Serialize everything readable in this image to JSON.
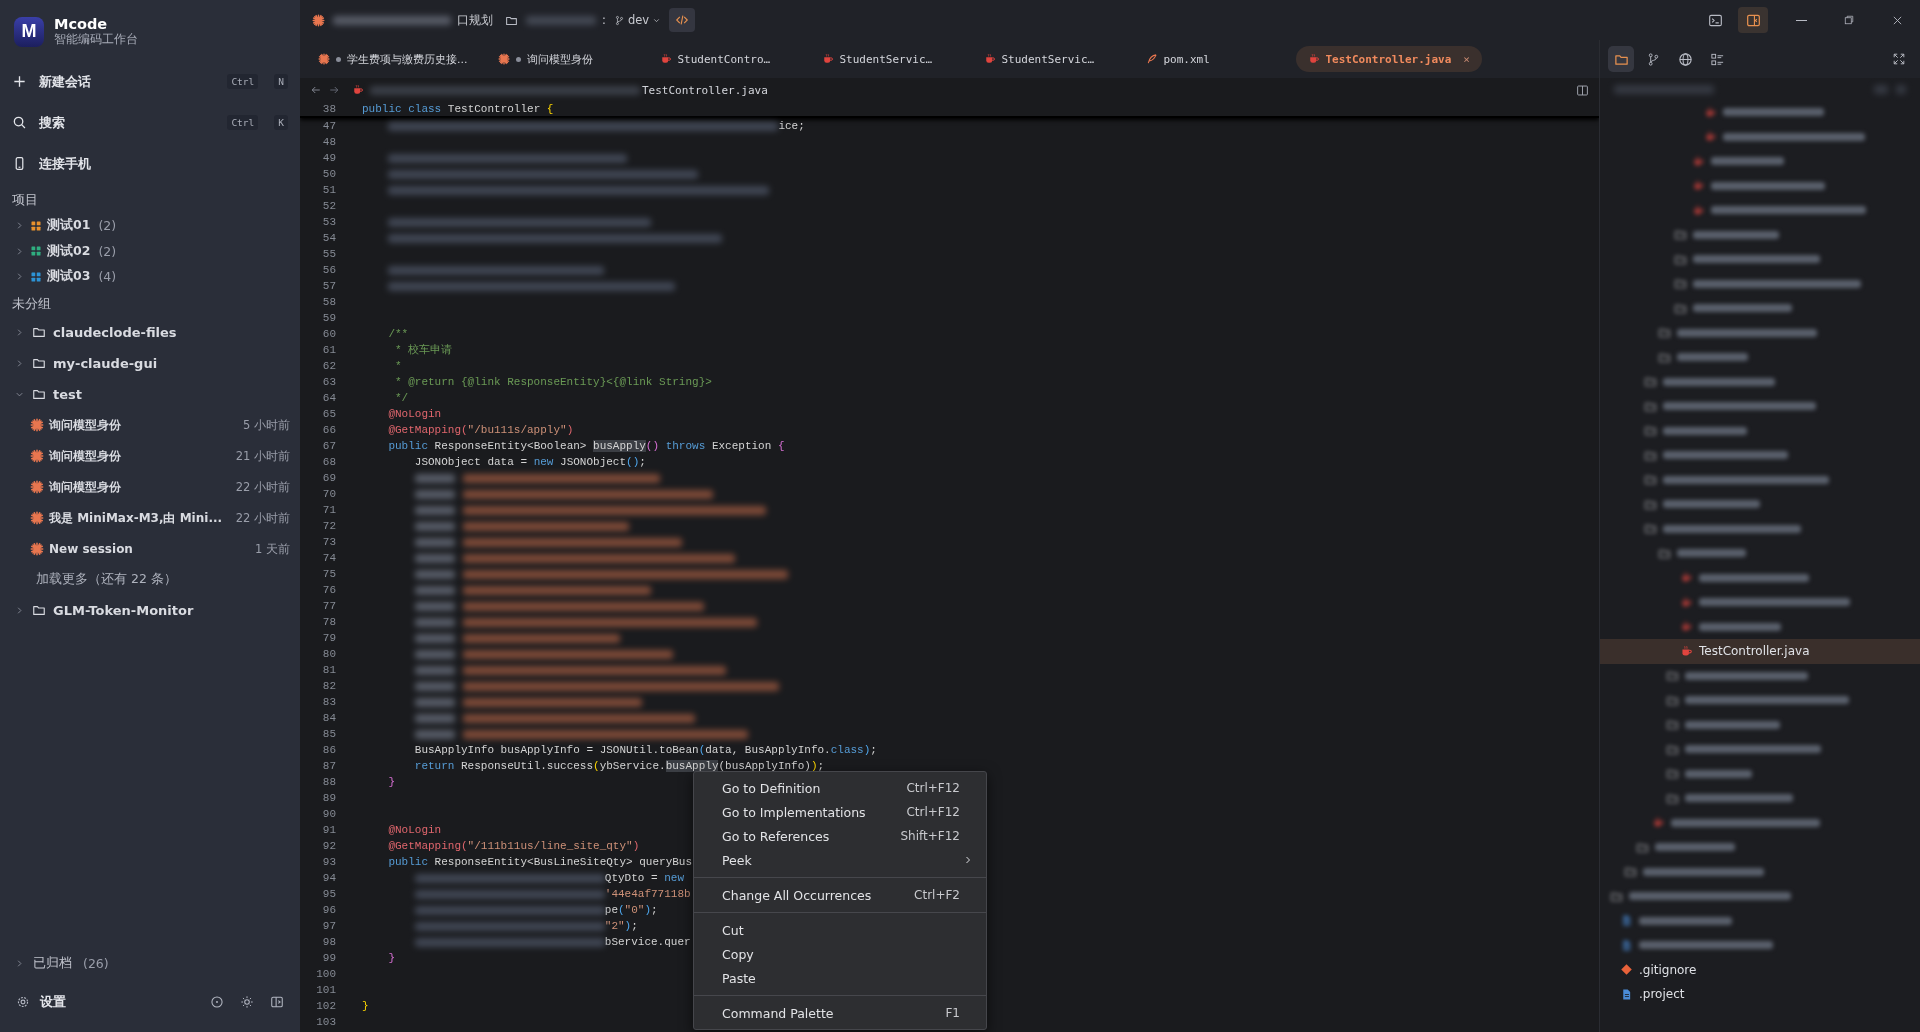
{
  "sidebar": {
    "brand": {
      "logo": "M",
      "name": "Mcode",
      "subtitle": "智能编码工作台"
    },
    "actions": [
      {
        "label": "新建会话",
        "keys": [
          "Ctrl",
          "N"
        ]
      },
      {
        "label": "搜索",
        "keys": [
          "Ctrl",
          "K"
        ]
      },
      {
        "label": "连接手机"
      }
    ],
    "projects_heading": "项目",
    "projects": [
      {
        "label": "测试01",
        "count": "(2)",
        "color": "#e8912d",
        "expanded": false
      },
      {
        "label": "测试02",
        "count": "(2)",
        "color": "#2fae80",
        "expanded": false
      },
      {
        "label": "测试03",
        "count": "(4)",
        "color": "#2c93d6",
        "expanded": false
      }
    ],
    "ungrouped_heading": "未分组",
    "groups": [
      {
        "label": "claudeclode-files",
        "expanded": false
      },
      {
        "label": "my-claude-gui",
        "expanded": false
      },
      {
        "label": "test",
        "expanded": true,
        "sessions": [
          {
            "title": "询问模型身份",
            "time": "5 小时前"
          },
          {
            "title": "询问模型身份",
            "time": "21 小时前"
          },
          {
            "title": "询问模型身份",
            "time": "22 小时前"
          },
          {
            "title": "我是 MiniMax-M3,由 Mini...",
            "time": "22 小时前"
          },
          {
            "title": "New session",
            "time": "1 天前"
          }
        ],
        "load_more": "加载更多（还有 22 条）"
      },
      {
        "label": "GLM-Token-Monitor",
        "expanded": false
      }
    ],
    "archived": {
      "label": "已归档",
      "count": "(26)",
      "expanded": false
    },
    "settings": "设置"
  },
  "topbar": {
    "project": "口规划",
    "separator": ":",
    "branch": "dev"
  },
  "tabs": [
    {
      "label": "学生费项与缴费历史接...",
      "kind": "session",
      "modified": true,
      "selected": false
    },
    {
      "label": "询问模型身份",
      "kind": "session",
      "modified": true,
      "selected": false
    },
    {
      "label": "StudentContro…",
      "kind": "java",
      "modified": false,
      "selected": false
    },
    {
      "label": "StudentServic…",
      "kind": "java",
      "modified": false,
      "selected": false
    },
    {
      "label": "StudentServic…",
      "kind": "java",
      "modified": false,
      "selected": false
    },
    {
      "label": "pom.xml",
      "kind": "xml",
      "modified": false,
      "selected": false
    },
    {
      "label": "TestController.java",
      "kind": "java",
      "modified": false,
      "selected": true,
      "close": "×"
    }
  ],
  "breadcrumb": {
    "file": "TestController.java"
  },
  "code": {
    "sticky": {
      "n": "38",
      "segments": [
        {
          "kind": "kw",
          "text": "public class "
        },
        {
          "kind": "txt",
          "text": "TestController "
        },
        {
          "kind": "br1",
          "text": "{"
        }
      ]
    },
    "lines": [
      {
        "n": "47",
        "kind": "member",
        "blurred": true,
        "segments": [
          {
            "kind": "txt",
            "text": "ice;"
          }
        ]
      },
      {
        "n": "48",
        "kind": "blank"
      },
      {
        "n": "49",
        "kind": "member",
        "blurred": true
      },
      {
        "n": "50",
        "kind": "member",
        "blurred": true
      },
      {
        "n": "51",
        "kind": "member",
        "blurred": true
      },
      {
        "n": "52",
        "kind": "blank"
      },
      {
        "n": "53",
        "kind": "member",
        "blurred": true
      },
      {
        "n": "54",
        "kind": "member",
        "blurred": true
      },
      {
        "n": "55",
        "kind": "blank"
      },
      {
        "n": "56",
        "kind": "member",
        "blurred": true
      },
      {
        "n": "57",
        "kind": "member",
        "blurred": true
      },
      {
        "n": "58",
        "kind": "blank"
      },
      {
        "n": "59",
        "kind": "blank"
      },
      {
        "n": "60",
        "kind": "member",
        "segments": [
          {
            "kind": "cmt",
            "text": "/**"
          }
        ]
      },
      {
        "n": "61",
        "kind": "member",
        "segments": [
          {
            "kind": "cmt",
            "text": " * 校车申请"
          }
        ]
      },
      {
        "n": "62",
        "kind": "member",
        "segments": [
          {
            "kind": "cmt",
            "text": " *"
          }
        ]
      },
      {
        "n": "63",
        "kind": "member",
        "segments": [
          {
            "kind": "cmt",
            "text": " * @return {@link ResponseEntity}<{@link String}>"
          }
        ]
      },
      {
        "n": "64",
        "kind": "member",
        "segments": [
          {
            "kind": "cmt",
            "text": " */"
          }
        ]
      },
      {
        "n": "65",
        "kind": "member",
        "segments": [
          {
            "kind": "ann",
            "text": "@NoLogin"
          }
        ]
      },
      {
        "n": "66",
        "kind": "member",
        "segments": [
          {
            "kind": "ann",
            "text": "@GetMapping("
          },
          {
            "kind": "str",
            "text": "\"/bu111s/apply\""
          },
          {
            "kind": "ann",
            "text": ")"
          }
        ]
      },
      {
        "n": "67",
        "kind": "member",
        "segments": [
          {
            "kind": "kw",
            "text": "public "
          },
          {
            "kind": "txt",
            "text": "ResponseEntity<Boolean> "
          },
          {
            "kind": "hl",
            "text": "busApply"
          },
          {
            "kind": "br2",
            "text": "()"
          },
          {
            "kind": "kw",
            "text": " throws "
          },
          {
            "kind": "txt",
            "text": "Exception "
          },
          {
            "kind": "br2",
            "text": "{"
          }
        ]
      },
      {
        "n": "68",
        "kind": "body",
        "segments": [
          {
            "kind": "txt",
            "text": "JSONObject data = "
          },
          {
            "kind": "kw",
            "text": "new "
          },
          {
            "kind": "txt",
            "text": "JSONObject"
          },
          {
            "kind": "br3",
            "text": "()"
          },
          {
            "kind": "txt",
            "text": ";"
          }
        ]
      },
      {
        "n": "69",
        "kind": "body",
        "blurred": true
      },
      {
        "n": "70",
        "kind": "body",
        "blurred": true
      },
      {
        "n": "71",
        "kind": "body",
        "blurred": true
      },
      {
        "n": "72",
        "kind": "body",
        "blurred": true
      },
      {
        "n": "73",
        "kind": "body",
        "blurred": true
      },
      {
        "n": "74",
        "kind": "body",
        "blurred": true
      },
      {
        "n": "75",
        "kind": "body",
        "blurred": true
      },
      {
        "n": "76",
        "kind": "body",
        "blurred": true
      },
      {
        "n": "77",
        "kind": "body",
        "blurred": true
      },
      {
        "n": "78",
        "kind": "body",
        "blurred": true
      },
      {
        "n": "79",
        "kind": "body",
        "blurred": true
      },
      {
        "n": "80",
        "kind": "body",
        "blurred": true
      },
      {
        "n": "81",
        "kind": "body",
        "blurred": true
      },
      {
        "n": "82",
        "kind": "body",
        "blurred": true
      },
      {
        "n": "83",
        "kind": "body",
        "blurred": true
      },
      {
        "n": "84",
        "kind": "body",
        "blurred": true
      },
      {
        "n": "85",
        "kind": "body",
        "blurred": true
      },
      {
        "n": "86",
        "kind": "body",
        "segments": [
          {
            "kind": "txt",
            "text": "BusApplyInfo busApplyInfo = JSONUtil.toBean"
          },
          {
            "kind": "br3",
            "text": "("
          },
          {
            "kind": "txt",
            "text": "data, BusApplyInfo."
          },
          {
            "kind": "kw",
            "text": "class"
          },
          {
            "kind": "br3",
            "text": ")"
          },
          {
            "kind": "txt",
            "text": ";"
          }
        ]
      },
      {
        "n": "87",
        "kind": "body",
        "segments": [
          {
            "kind": "kw",
            "text": "return "
          },
          {
            "kind": "txt",
            "text": "ResponseUtil.success"
          },
          {
            "kind": "br1",
            "text": "("
          },
          {
            "kind": "txt",
            "text": "ybService."
          },
          {
            "kind": "hl",
            "text": "busApply"
          },
          {
            "kind": "txt",
            "text": "(busApplyInfo)"
          },
          {
            "kind": "br1",
            "text": ")"
          },
          {
            "kind": "txt",
            "text": ";"
          }
        ]
      },
      {
        "n": "88",
        "kind": "member",
        "segments": [
          {
            "kind": "br2",
            "text": "}"
          }
        ]
      },
      {
        "n": "89",
        "kind": "blank"
      },
      {
        "n": "90",
        "kind": "blank"
      },
      {
        "n": "91",
        "kind": "member",
        "segments": [
          {
            "kind": "ann",
            "text": "@NoLogin"
          }
        ]
      },
      {
        "n": "92",
        "kind": "member",
        "segments": [
          {
            "kind": "ann",
            "text": "@GetMapping("
          },
          {
            "kind": "str",
            "text": "\"/111b11us/line_site_qty\""
          },
          {
            "kind": "ann",
            "text": ")"
          }
        ]
      },
      {
        "n": "93",
        "kind": "member",
        "segments": [
          {
            "kind": "kw",
            "text": "public "
          },
          {
            "kind": "txt",
            "text": "ResponseEntity<BusLineSiteQty> queryBus"
          }
        ]
      },
      {
        "n": "94",
        "kind": "body",
        "blurred": true,
        "segments": [
          {
            "kind": "txt",
            "text": "QtyDto = "
          },
          {
            "kind": "kw",
            "text": "new"
          }
        ]
      },
      {
        "n": "95",
        "kind": "body",
        "blurred": true,
        "segments": [
          {
            "kind": "str",
            "text": "'44e4af77118b"
          }
        ]
      },
      {
        "n": "96",
        "kind": "body",
        "blurred": true,
        "segments": [
          {
            "kind": "txt",
            "text": "pe"
          },
          {
            "kind": "br3",
            "text": "("
          },
          {
            "kind": "str",
            "text": "\"0\""
          },
          {
            "kind": "br3",
            "text": ")"
          },
          {
            "kind": "txt",
            "text": ";"
          }
        ]
      },
      {
        "n": "97",
        "kind": "body",
        "blurred": true,
        "segments": [
          {
            "kind": "str",
            "text": "\"2\""
          },
          {
            "kind": "br3",
            "text": ")"
          },
          {
            "kind": "txt",
            "text": ";"
          }
        ]
      },
      {
        "n": "98",
        "kind": "body",
        "blurred": true,
        "segments": [
          {
            "kind": "txt",
            "text": "bService.quer"
          }
        ]
      },
      {
        "n": "99",
        "kind": "member",
        "segments": [
          {
            "kind": "br2",
            "text": "}"
          }
        ]
      },
      {
        "n": "100",
        "kind": "blank"
      },
      {
        "n": "101",
        "kind": "blank"
      },
      {
        "n": "102",
        "kind": "class",
        "segments": [
          {
            "kind": "br1",
            "text": "}"
          }
        ]
      },
      {
        "n": "103",
        "kind": "blank"
      }
    ]
  },
  "context_menu": [
    {
      "kind": "item",
      "label": "Go to Definition",
      "shortcut": "Ctrl+F12"
    },
    {
      "kind": "item",
      "label": "Go to Implementations",
      "shortcut": "Ctrl+F12"
    },
    {
      "kind": "item",
      "label": "Go to References",
      "shortcut": "Shift+F12"
    },
    {
      "kind": "submenu",
      "label": "Peek"
    },
    {
      "kind": "separator"
    },
    {
      "kind": "item",
      "label": "Change All Occurrences",
      "shortcut": "Ctrl+F2"
    },
    {
      "kind": "separator"
    },
    {
      "kind": "item",
      "label": "Cut"
    },
    {
      "kind": "item",
      "label": "Copy"
    },
    {
      "kind": "item",
      "label": "Paste"
    },
    {
      "kind": "separator"
    },
    {
      "kind": "item",
      "label": "Command Palette",
      "shortcut": "F1"
    }
  ],
  "file_tree": [
    {
      "kind": "java",
      "label": "TestController.java",
      "selected": true
    },
    {
      "kind": "git",
      "label": ".gitignore",
      "selected": false
    },
    {
      "kind": "doc",
      "label": ".project",
      "selected": false
    }
  ]
}
